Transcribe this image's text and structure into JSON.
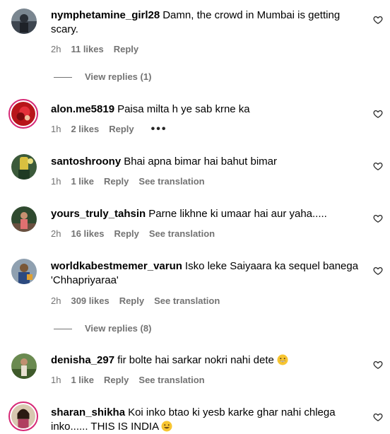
{
  "comments": [
    {
      "username": "nymphetamine_girl28",
      "text": "Damn, the crowd in Mumbai is getting scary.",
      "time": "2h",
      "likes": "11 likes",
      "reply": "Reply",
      "view_replies": "View replies (1)"
    },
    {
      "username": "alon.me5819",
      "text": "Paisa milta h ye sab krne ka",
      "time": "1h",
      "likes": "2 likes",
      "reply": "Reply",
      "more": "•••"
    },
    {
      "username": "santoshroony",
      "text": "Bhai apna bimar hai bahut bimar",
      "time": "1h",
      "likes": "1 like",
      "reply": "Reply",
      "translate": "See translation"
    },
    {
      "username": "yours_truly_tahsin",
      "text": "Parne likhne ki umaar hai aur yaha.....",
      "time": "2h",
      "likes": "16 likes",
      "reply": "Reply",
      "translate": "See translation"
    },
    {
      "username": "worldkabestmemer_varun",
      "text": "Isko leke Saiyaara ka sequel banega 'Chhapriyaraa'",
      "time": "2h",
      "likes": "309 likes",
      "reply": "Reply",
      "translate": "See translation",
      "view_replies": "View replies (8)"
    },
    {
      "username": "denisha_297",
      "text": "fir bolte hai sarkar nokri nahi dete",
      "time": "1h",
      "likes": "1 like",
      "reply": "Reply",
      "translate": "See translation"
    },
    {
      "username": "sharan_shikha",
      "text": "Koi inko btao ki yesb karke ghar nahi chlega inko...... THIS IS INDIA"
    }
  ],
  "icons": {
    "like": "heart-outline-icon",
    "emoji": "grinning-face-emoji"
  },
  "colors": {
    "story_ring": "#d62976",
    "meta_text": "#737373"
  }
}
